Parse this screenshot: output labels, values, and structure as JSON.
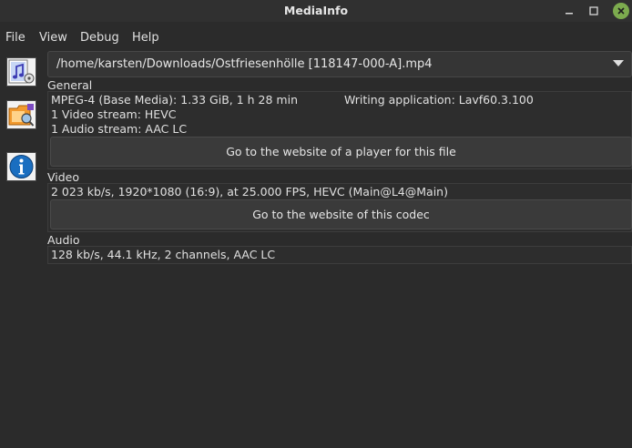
{
  "window": {
    "title": "MediaInfo"
  },
  "menu": {
    "file": "File",
    "view": "View",
    "debug": "Debug",
    "help": "Help"
  },
  "file_selector": {
    "value": "/home/karsten/Downloads/Ostfriesenhölle [118147-000-A].mp4"
  },
  "general": {
    "title": "General",
    "format": "MPEG-4 (Base Media): 1.33 GiB, 1 h 28 min",
    "writing_app": "Writing application: Lavf60.3.100",
    "video_streams": "1 Video stream: HEVC",
    "audio_streams": "1 Audio stream: AAC LC",
    "player_button": "Go to the website of a player for this file"
  },
  "video": {
    "title": "Video",
    "details": "2 023 kb/s, 1920*1080 (16:9), at 25.000 FPS, HEVC (Main@L4@Main)",
    "codec_button": "Go to the website of this codec"
  },
  "audio": {
    "title": "Audio",
    "details": "128 kb/s, 44.1 kHz, 2 channels, AAC LC"
  },
  "icons": {
    "basic_view": "music-file-icon",
    "sheet_view": "media-folder-icon",
    "info": "info-icon"
  },
  "colors": {
    "background": "#2b2b2b",
    "close_button": "#7cab4e",
    "info_blue": "#1a6ec0"
  }
}
